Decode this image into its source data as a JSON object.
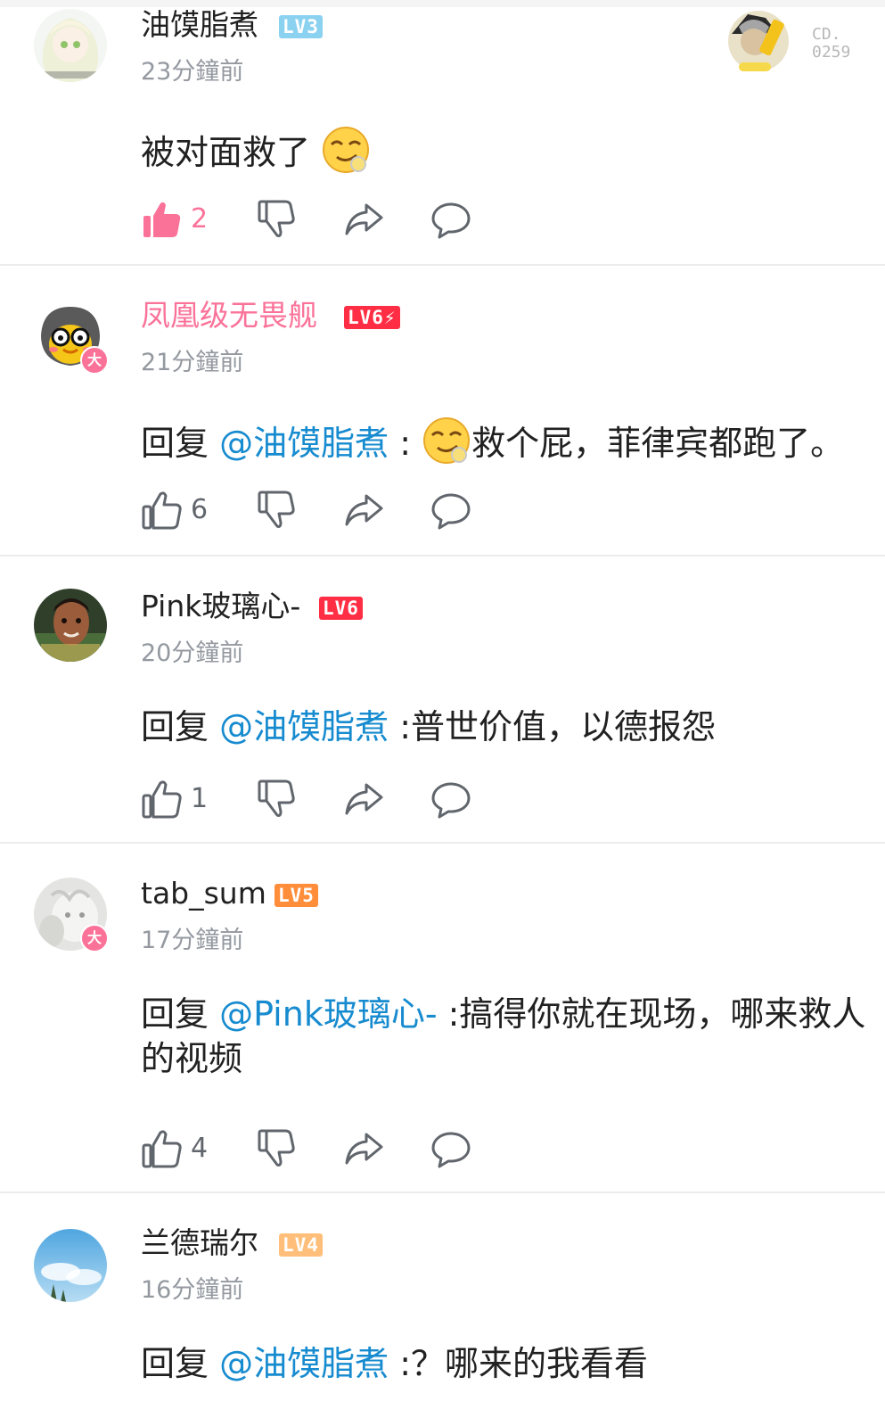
{
  "comments": [
    {
      "username": "油馍脂煮",
      "level": "LV3",
      "time": "23分鐘前",
      "content": "被对面救了",
      "likes": "2",
      "liked": true,
      "big_member": false
    },
    {
      "username": "凤凰级无畏舰",
      "level": "LV6⚡",
      "time": "21分鐘前",
      "reply_prefix": "回复 ",
      "mention": "@油馍脂煮",
      "content": " : 救个屁，菲律宾都跑了。",
      "likes": "6",
      "big_member": true
    },
    {
      "username": "Pink玻璃心-",
      "level": "LV6",
      "time": "20分鐘前",
      "reply_prefix": "回复 ",
      "mention": "@油馍脂煮",
      "content": " :普世价值，以德报怨",
      "likes": "1",
      "big_member": false
    },
    {
      "username": "tab_sum",
      "level": "LV5",
      "time": "17分鐘前",
      "reply_prefix": "回复 ",
      "mention": "@Pink玻璃心-",
      "content": " :搞得你就在现场，哪来救人的视频",
      "likes": "4",
      "big_member": true
    },
    {
      "username": "兰德瑞尔",
      "level": "LV4",
      "time": "16分鐘前",
      "reply_prefix": "回复 ",
      "mention": "@油馍脂煮",
      "content": " :？哪来的我看看",
      "big_member": false
    }
  ],
  "big_member_badge": "大",
  "decoration_text": "CD.\n0259",
  "colors": {
    "pink": "#fb7299",
    "mention": "#178bcf",
    "lv3": "#8bd2f0",
    "lv4": "#ffbf7a",
    "lv5": "#ff8d3a",
    "lv6": "#ff2e44",
    "gray": "#9499a0"
  },
  "icons": {
    "like": "thumbs-up-icon",
    "dislike": "thumbs-down-icon",
    "share": "share-arrow-icon",
    "reply": "comment-bubble-icon"
  }
}
